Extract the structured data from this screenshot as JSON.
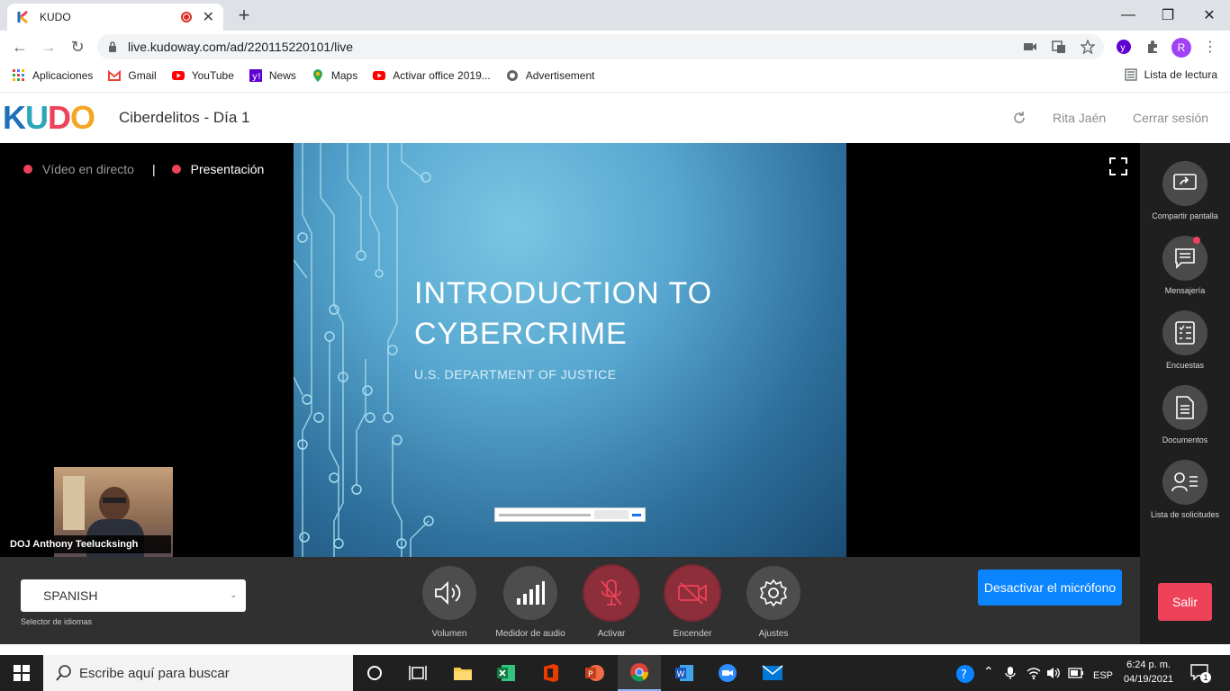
{
  "browser": {
    "tab_title": "KUDO",
    "url": "live.kudoway.com/ad/220115220101/live",
    "profile_initial": "R",
    "bookmarks": [
      {
        "label": "Aplicaciones",
        "icon": "apps-grid-icon"
      },
      {
        "label": "Gmail",
        "icon": "gmail-icon"
      },
      {
        "label": "YouTube",
        "icon": "youtube-icon"
      },
      {
        "label": "News",
        "icon": "yahoo-icon"
      },
      {
        "label": "Maps",
        "icon": "maps-icon"
      },
      {
        "label": "Activar office 2019...",
        "icon": "youtube-icon"
      },
      {
        "label": "Advertisement",
        "icon": "globe-icon"
      }
    ],
    "reading_list": "Lista de lectura"
  },
  "app": {
    "logo_text": "KUDO",
    "event_title": "Ciberdelitos - Día 1",
    "user_name": "Rita Jaén",
    "logout_label": "Cerrar sesión"
  },
  "stage": {
    "view_live": "Vídeo en directo",
    "view_separator": "|",
    "view_presentation": "Presentación",
    "slide_title_line1": "INTRODUCTION TO",
    "slide_title_line2": "CYBERCRIME",
    "slide_subtitle": "U.S. DEPARTMENT OF JUSTICE",
    "speaker_name": "DOJ Anthony Teelucksingh"
  },
  "sidebar": {
    "items": [
      {
        "label": "Compartir pantalla",
        "icon": "share-screen-icon"
      },
      {
        "label": "Mensajería",
        "icon": "chat-icon"
      },
      {
        "label": "Encuestas",
        "icon": "poll-icon"
      },
      {
        "label": "Documentos",
        "icon": "document-icon"
      },
      {
        "label": "Lista de solicitudes",
        "icon": "request-list-icon"
      }
    ]
  },
  "controls": {
    "language_value": "SPANISH",
    "language_label": "Selector de idiomas",
    "buttons": [
      {
        "label": "Volumen",
        "icon": "volume-icon"
      },
      {
        "label": "Medidor de audio",
        "icon": "audio-meter-icon"
      },
      {
        "label": "Activar",
        "icon": "mic-off-icon"
      },
      {
        "label": "Encender",
        "icon": "camera-off-icon"
      },
      {
        "label": "Ajustes",
        "icon": "gear-icon"
      }
    ],
    "mute_label": "Desactivar el micrófono",
    "exit_label": "Salir"
  },
  "taskbar": {
    "search_placeholder": "Escribe aquí para buscar",
    "language": "ESP",
    "time": "6:24 p. m.",
    "date": "04/19/2021",
    "notifications": "1"
  },
  "colors": {
    "accent_red": "#ed4259",
    "accent_blue": "#0a84ff",
    "control_bar": "#303030",
    "sidebar": "#1f1f1f"
  }
}
